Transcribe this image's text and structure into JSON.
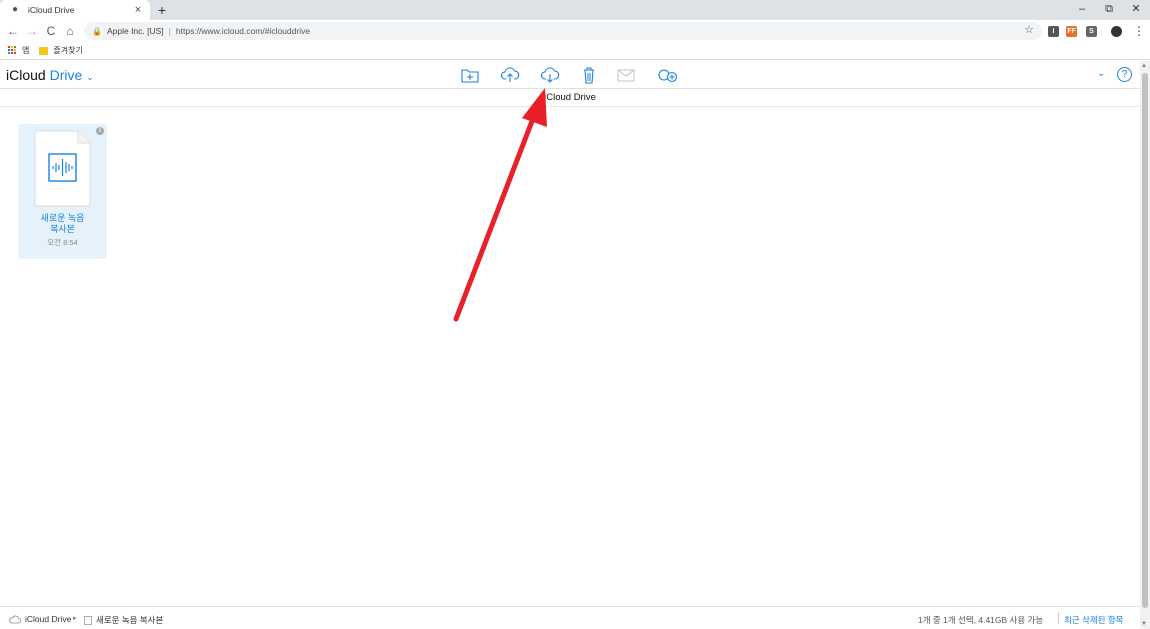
{
  "browser": {
    "tab_title": "iCloud Drive",
    "tab_close": "×",
    "new_tab": "+",
    "window_controls": {
      "minimize": "–",
      "restore": "⧉",
      "close": "✕"
    },
    "nav": {
      "back": "←",
      "forward": "→",
      "reload": "C",
      "home": "⌂"
    },
    "address": {
      "org": "Apple Inc. [US]",
      "separator": "|",
      "url": "https://www.icloud.com/#iclouddrive"
    },
    "extensions": [
      "I",
      "FF",
      "S"
    ],
    "menu": "⋮",
    "bookmarks": {
      "apps_label": "앱",
      "folder_label": "즐겨찾기"
    }
  },
  "icloud": {
    "brand": "iCloud",
    "app": "Drive",
    "app_chevron": "⌄",
    "toolbar": [
      "new-folder-icon",
      "upload-icon",
      "download-icon",
      "trash-icon",
      "email-icon",
      "share-icon"
    ],
    "subtitle": "iCloud Drive",
    "help": "?",
    "header_chevron": "⌄"
  },
  "files": [
    {
      "name_line1": "새로운 녹음",
      "name_line2": "복사본",
      "time": "오전 8:54",
      "info": "i"
    }
  ],
  "footer": {
    "crumb_root": "iCloud Drive",
    "crumb_sep": "▸",
    "crumb_file": "새로운 녹음 복사본",
    "status": "1개 중 1개 선택, 4.41GB 사용 가능",
    "trash_link": "최근 삭제된 항목"
  },
  "colors": {
    "accent": "#1a82e2",
    "tile_selected": "#e5f1fb",
    "annotation": "#e8202a"
  }
}
